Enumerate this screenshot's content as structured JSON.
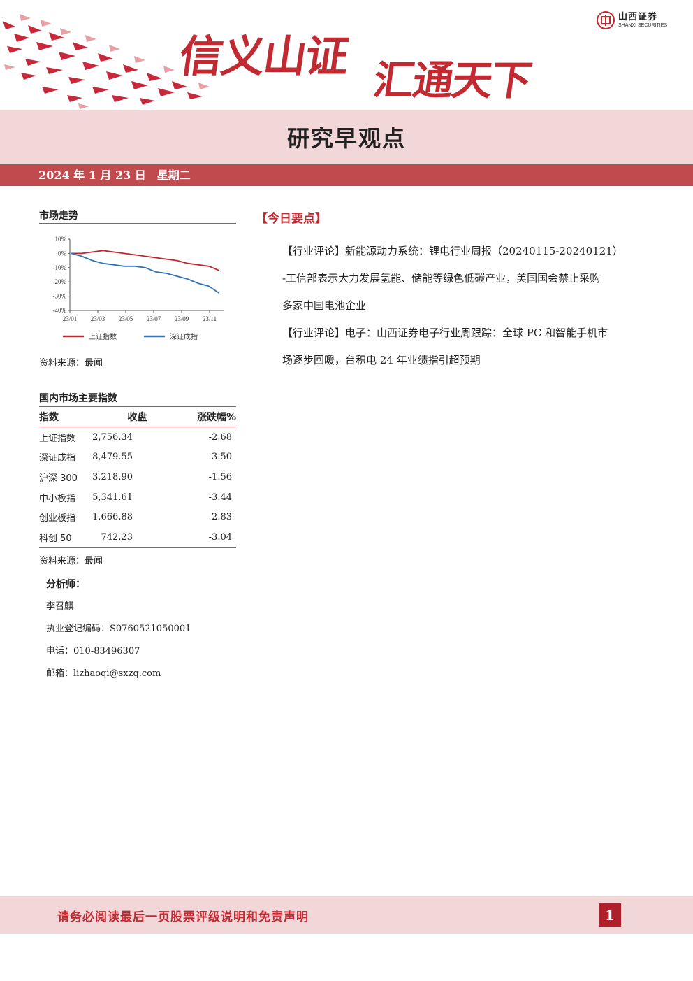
{
  "header": {
    "slogan_part1": "信义山证",
    "slogan_part2": "汇通天下",
    "logo_cn": "山西证券",
    "logo_en": "SHANXI SECURITIES",
    "brand_color": "#c22a32"
  },
  "report_title": "研究早观点",
  "date_line": "2024 年 1 月 23 日　星期二",
  "market_trend": {
    "title": "市场走势",
    "source": "资料来源：最闻"
  },
  "chart_data": {
    "type": "line",
    "x": [
      "23/01",
      "23/03",
      "23/05",
      "23/07",
      "23/09",
      "23/11"
    ],
    "xlabel": "",
    "ylabel": "",
    "ylim": [
      -40,
      10
    ],
    "y_ticks": [
      "10%",
      "0%",
      "-10%",
      "-20%",
      "-30%",
      "-40%"
    ],
    "y_tick_values": [
      10,
      0,
      -10,
      -20,
      -30,
      -40
    ],
    "grid": false,
    "legend": "bottom",
    "series": [
      {
        "name": "上证指数",
        "color": "#c0262e",
        "values": [
          0,
          0,
          1,
          2,
          1,
          0,
          -1,
          -2,
          -3,
          -4,
          -5,
          -7,
          -8,
          -9,
          -12
        ]
      },
      {
        "name": "深证成指",
        "color": "#2e75b6",
        "values": [
          0,
          -2,
          -5,
          -7,
          -8,
          -9,
          -9,
          -10,
          -13,
          -14,
          -16,
          -18,
          -21,
          -23,
          -28
        ]
      }
    ]
  },
  "index_table": {
    "title": "国内市场主要指数",
    "headers": [
      "指数",
      "收盘",
      "涨跌幅%"
    ],
    "rows": [
      {
        "name": "上证指数",
        "close": "2,756.34",
        "change": "-2.68"
      },
      {
        "name": "深证成指",
        "close": "8,479.55",
        "change": "-3.50"
      },
      {
        "name": "沪深 300",
        "close": "3,218.90",
        "change": "-1.56"
      },
      {
        "name": "中小板指",
        "close": "5,341.61",
        "change": "-3.44"
      },
      {
        "name": "创业板指",
        "close": "1,666.88",
        "change": "-2.83"
      },
      {
        "name": "科创 50",
        "close": "742.23",
        "change": "-3.04"
      }
    ],
    "source": "资料来源：最闻"
  },
  "analyst": {
    "label": "分析师：",
    "name": "李召麒",
    "reg": "执业登记编码：S0760521050001",
    "phone": "电话：010-83496307",
    "email": "邮箱：lizhaoqi@sxzq.com"
  },
  "key_points": {
    "title": "【今日要点】",
    "items": [
      {
        "line1": "【行业评论】新能源动力系统：锂电行业周报（20240115-20240121）",
        "line2": "-工信部表示大力发展氢能、储能等绿色低碳产业，美国国会禁止采购",
        "line3": "多家中国电池企业"
      },
      {
        "line1": "【行业评论】电子：山西证券电子行业周跟踪：全球 PC 和智能手机市",
        "line2": "场逐步回暖，台积电 24 年业绩指引超预期"
      }
    ]
  },
  "footer": {
    "notice": "请务必阅读最后一页股票评级说明和免责声明",
    "page": "1"
  }
}
